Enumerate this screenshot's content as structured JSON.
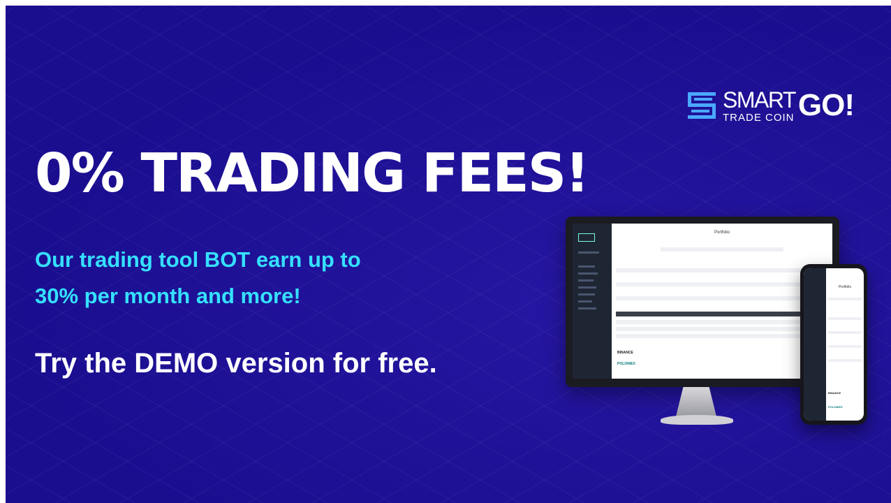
{
  "brand": {
    "name_line1": "SMART",
    "name_line2": "TRADE COIN",
    "suffix": "GO!",
    "colors": {
      "background": "#1a0e8f",
      "accent": "#35e0ff",
      "logo_mark": "#4aa8ff"
    }
  },
  "headline": "0% TRADING FEES!",
  "subheadline": {
    "line1": "Our trading tool BOT earn up to",
    "line2": "30% per month and more!"
  },
  "cta": "Try the DEMO version for free.",
  "device_mockup": {
    "screen_title": "Portfolio",
    "exchanges": [
      "BINANCE",
      "POLONIEX"
    ]
  }
}
